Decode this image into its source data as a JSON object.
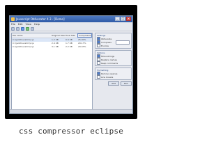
{
  "window": {
    "title": "Javascript Obfuscator 4.3 - [Demo]",
    "menu": [
      "File",
      "Edit",
      "View",
      "Help"
    ]
  },
  "file_list": {
    "columns": [
      "File name",
      "Original Size",
      "Final Size",
      "Compression ratio"
    ],
    "rows": [
      {
        "name": "C:\\\\jsobfuscator\\\\1.js",
        "original": "1.2 KB",
        "final": "0.9 KB",
        "ratio": "25.00%"
      },
      {
        "name": "C:\\\\jsobfuscator\\\\2.js",
        "original": "2.4 KB",
        "final": "1.7 KB",
        "ratio": "29.17%"
      },
      {
        "name": "C:\\\\jsobfuscator\\\\3.js",
        "original": "3.1 KB",
        "final": "2.2 KB",
        "ratio": "29.03%"
      }
    ]
  },
  "options": {
    "group1_title": "Settings",
    "group1_items": [
      "Obfuscate",
      "Compress",
      "Encode"
    ],
    "group2_title": "Options",
    "group2_items": [
      "Move strings",
      "Replace names",
      "Keep comments"
    ],
    "group3_title": "Formatting",
    "group3_items": [
      "Remove spaces",
      "Line breaks"
    ],
    "buttons": [
      "Add",
      "Run"
    ]
  },
  "caption": "css compressor eclipse"
}
